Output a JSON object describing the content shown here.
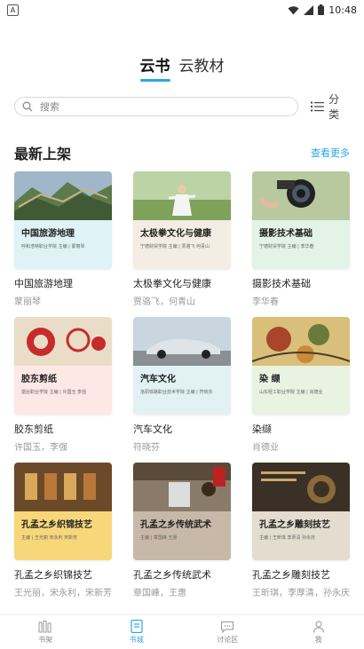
{
  "status_bar": {
    "app_indicator": "A",
    "time": "10:48"
  },
  "top_tabs": [
    {
      "label": "云书",
      "active": true
    },
    {
      "label": "云教材",
      "active": false
    }
  ],
  "search": {
    "placeholder": "搜索"
  },
  "category_label": "分类",
  "section": {
    "title": "最新上架",
    "more_label": "查看更多"
  },
  "books": [
    {
      "cover_title": "中国旅游地理",
      "cover_sub": "呼和浩特职业学院 主编 | 蒙丽琴",
      "title": "中国旅游地理",
      "author": "蒙丽琴",
      "band_color": "#dff3f6",
      "scene": "wall"
    },
    {
      "cover_title": "太极拳文化与健康",
      "cover_sub": "宁德财贸学院 主编 | 贾骆飞  何青山",
      "title": "太极拳文化与健康",
      "author": "贾骆飞，何青山",
      "band_color": "#f3ede4",
      "scene": "taichi"
    },
    {
      "cover_title": "摄影技术基础",
      "cover_sub": "宁德财贸学院  主编 | 李华春",
      "title": "摄影技术基础",
      "author": "李华春",
      "band_color": "#e4f3e7",
      "scene": "camera"
    },
    {
      "cover_title": "胶东剪纸",
      "cover_sub": "烟台职业学院 主编 | 许国玉  李强",
      "title": "胶东剪纸",
      "author": "许国玉，李强",
      "band_color": "#fde8e6",
      "scene": "papercut"
    },
    {
      "cover_title": "汽车文化",
      "cover_sub": "洛阳铁路职业技术学院 主编 | 符晓芬",
      "title": "汽车文化",
      "author": "符晓芬",
      "band_color": "#e2f2f4",
      "scene": "car"
    },
    {
      "cover_title": "染  缬",
      "cover_sub": "山东轻工职业学院  主编 | 肖德业",
      "title": "染缬",
      "author": "肖德业",
      "band_color": "#e9f3e2",
      "scene": "dye"
    },
    {
      "cover_title": "孔孟之乡织锦技艺",
      "cover_sub": "主编 | 王光丽  宋永利  宋新芳",
      "title": "孔孟之乡织锦技艺",
      "author": "王光丽，宋永利，宋新芳",
      "band_color": "#f7d77a",
      "scene": "weave"
    },
    {
      "cover_title": "孔孟之乡传统武术",
      "cover_sub": "主编 | 章国峰  王惠",
      "title": "孔孟之乡传统武术",
      "author": "章国峰，王惠",
      "band_color": "#c8b8a8",
      "scene": "martial"
    },
    {
      "cover_title": "孔孟之乡雕刻技艺",
      "cover_sub": "主编 | 王昕琪  李厚清  孙永庆",
      "title": "孔孟之乡雕刻技艺",
      "author": "王昕琪，李厚清，孙永庆",
      "band_color": "#e4ddcf",
      "scene": "carve"
    }
  ],
  "bottom_nav": [
    {
      "label": "书架",
      "icon": "bookshelf-icon",
      "active": false
    },
    {
      "label": "书城",
      "icon": "bookstore-icon",
      "active": true
    },
    {
      "label": "讨论区",
      "icon": "discussion-icon",
      "active": false
    },
    {
      "label": "我",
      "icon": "profile-icon",
      "active": false
    }
  ],
  "colors": {
    "accent": "#2aa7e0"
  }
}
